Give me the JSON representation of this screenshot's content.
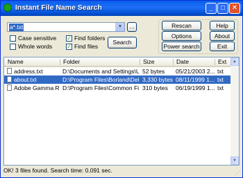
{
  "window": {
    "title": "Instant File Name Search"
  },
  "search": {
    "value": "a*.txt",
    "browse_label": "...",
    "search_label": "Search"
  },
  "options": {
    "case_sensitive": {
      "label": "Case sensitive",
      "checked": false
    },
    "whole_words": {
      "label": "Whole words",
      "checked": false
    },
    "find_folders": {
      "label": "Find folders",
      "checked": true
    },
    "find_files": {
      "label": "Find files",
      "checked": true
    }
  },
  "buttons": {
    "rescan": "Rescan",
    "options": "Options",
    "power_search": "Power search",
    "help": "Help",
    "about": "About",
    "exit": "Exit"
  },
  "table": {
    "columns": [
      "Name",
      "Folder",
      "Size",
      "Date",
      "Ext"
    ],
    "rows": [
      {
        "name": "address.txt",
        "folder": "D:\\Documents and Settings\\U...",
        "size": "52 bytes",
        "date": "05/21/2003 2...",
        "ext": "txt",
        "selected": false
      },
      {
        "name": "about.txt",
        "folder": "D:\\Program Files\\Borland\\Delp...",
        "size": "3,330 bytes",
        "date": "08/11/1999 1...",
        "ext": "txt",
        "selected": true
      },
      {
        "name": "Adobe Gamma Re...",
        "folder": "D:\\Program Files\\Common Files...",
        "size": "310 bytes",
        "date": "06/19/1999 1...",
        "ext": "txt",
        "selected": false
      }
    ]
  },
  "status": {
    "text": "OK! 3 files found. Search time: 0.091 sec."
  },
  "icons": {
    "app": "app-icon",
    "minimize": "minimize-icon",
    "maximize": "maximize-icon",
    "close": "close-icon",
    "dropdown": "chevron-down-icon",
    "file": "text-file-icon",
    "check": "checkmark-icon",
    "grip": "resize-grip-icon"
  },
  "colors": {
    "title_bar": "#0a5ee9",
    "selection": "#316ac5",
    "checkmark": "#21a121"
  }
}
